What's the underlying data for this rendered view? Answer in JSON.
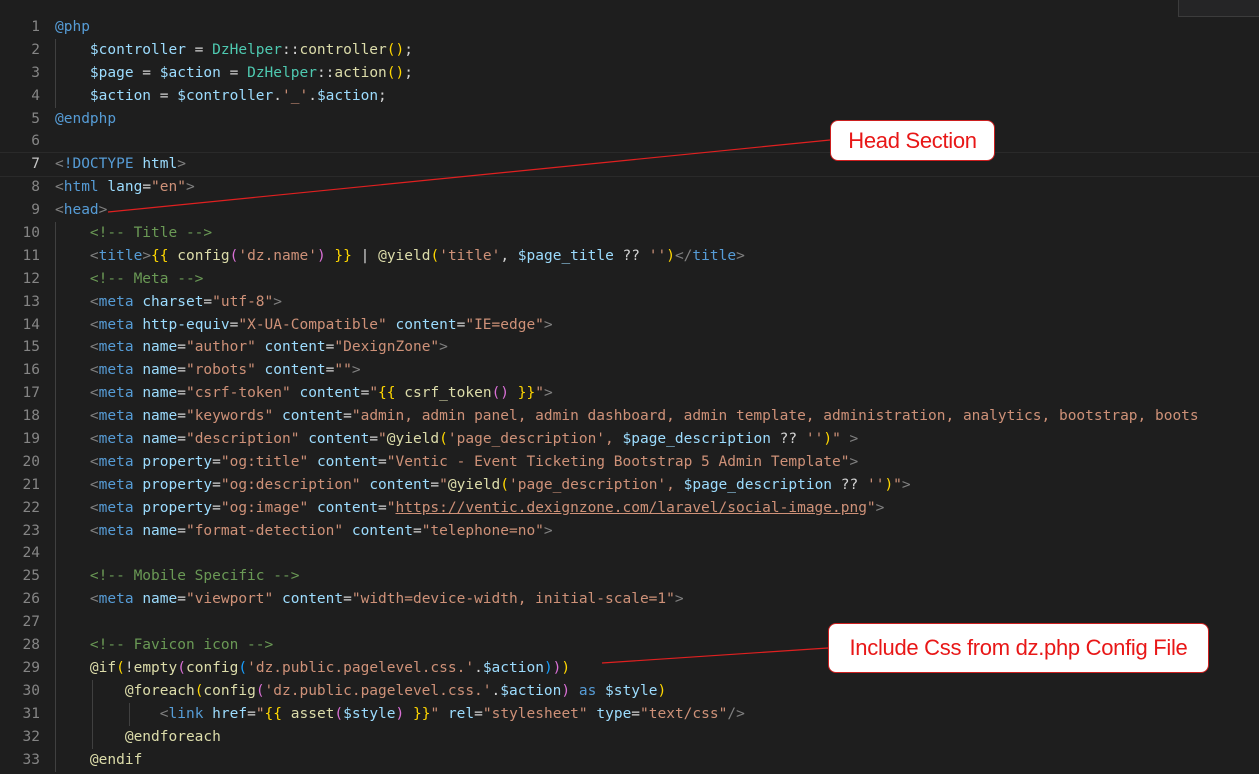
{
  "editor": {
    "lines": [
      {
        "n": "1",
        "html": "<span class='kw'>@php</span>"
      },
      {
        "n": "2",
        "html": "    <span class='var'>$controller</span> = <span class='cls'>DzHelper</span>::<span class='fn'>controller</span><span class='br1'>()</span>;"
      },
      {
        "n": "3",
        "html": "    <span class='var'>$page</span> = <span class='var'>$action</span> = <span class='cls'>DzHelper</span>::<span class='fn'>action</span><span class='br1'>()</span>;"
      },
      {
        "n": "4",
        "html": "    <span class='var'>$action</span> = <span class='var'>$controller</span>.<span class='str'>'_'</span>.<span class='var'>$action</span>;"
      },
      {
        "n": "5",
        "html": "<span class='kw'>@endphp</span>"
      },
      {
        "n": "6",
        "html": ""
      },
      {
        "n": "7",
        "html": "<span class='ang'>&lt;</span><span class='tag'>!DOCTYPE</span> <span class='attr'>html</span><span class='ang'>&gt;</span>",
        "current": true
      },
      {
        "n": "8",
        "html": "<span class='ang'>&lt;</span><span class='tag'>html</span> <span class='attr'>lang</span>=<span class='str'>\"en\"</span><span class='ang'>&gt;</span>"
      },
      {
        "n": "9",
        "html": "<span class='ang'>&lt;</span><span class='tag'>head</span><span class='ang'>&gt;</span>"
      },
      {
        "n": "10",
        "html": "    <span class='cmt'>&lt;!-- Title --&gt;</span>"
      },
      {
        "n": "11",
        "html": "    <span class='ang'>&lt;</span><span class='tag'>title</span><span class='ang'>&gt;</span><span class='br1'>{{</span> <span class='fn'>config</span><span class='br2'>(</span><span class='str'>'dz.name'</span><span class='br2'>)</span> <span class='br1'>}}</span> | <span class='fn'>@yield</span><span class='br1'>(</span><span class='str'>'title'</span>, <span class='var'>$page_title</span> ?? <span class='str'>''</span><span class='br1'>)</span><span class='ang'>&lt;/</span><span class='tag'>title</span><span class='ang'>&gt;</span>"
      },
      {
        "n": "12",
        "html": "    <span class='cmt'>&lt;!-- Meta --&gt;</span>"
      },
      {
        "n": "13",
        "html": "    <span class='ang'>&lt;</span><span class='tag'>meta</span> <span class='attr'>charset</span>=<span class='str'>\"utf-8\"</span><span class='ang'>&gt;</span>"
      },
      {
        "n": "14",
        "html": "    <span class='ang'>&lt;</span><span class='tag'>meta</span> <span class='attr'>http-equiv</span>=<span class='str'>\"X-UA-Compatible\"</span> <span class='attr'>content</span>=<span class='str'>\"IE=edge\"</span><span class='ang'>&gt;</span>"
      },
      {
        "n": "15",
        "html": "    <span class='ang'>&lt;</span><span class='tag'>meta</span> <span class='attr'>name</span>=<span class='str'>\"author\"</span> <span class='attr'>content</span>=<span class='str'>\"DexignZone\"</span><span class='ang'>&gt;</span>"
      },
      {
        "n": "16",
        "html": "    <span class='ang'>&lt;</span><span class='tag'>meta</span> <span class='attr'>name</span>=<span class='str'>\"robots\"</span> <span class='attr'>content</span>=<span class='str'>\"\"</span><span class='ang'>&gt;</span>"
      },
      {
        "n": "17",
        "html": "    <span class='ang'>&lt;</span><span class='tag'>meta</span> <span class='attr'>name</span>=<span class='str'>\"csrf-token\"</span> <span class='attr'>content</span>=<span class='str'>\"<span class='br1'>{{</span> <span class='fn'>csrf_token</span><span class='br2'>()</span> <span class='br1'>}}</span>\"</span><span class='ang'>&gt;</span>"
      },
      {
        "n": "18",
        "html": "    <span class='ang'>&lt;</span><span class='tag'>meta</span> <span class='attr'>name</span>=<span class='str'>\"keywords\"</span> <span class='attr'>content</span>=<span class='str'>\"admin, admin panel, admin dashboard, admin template, administration, analytics, bootstrap, boots</span>"
      },
      {
        "n": "19",
        "html": "    <span class='ang'>&lt;</span><span class='tag'>meta</span> <span class='attr'>name</span>=<span class='str'>\"description\"</span> <span class='attr'>content</span>=<span class='str'>\"<span class='fn'>@yield</span><span class='br1'>(</span>'page_description', <span class='var'>$page_description</span> <span class='txt'>??</span> ''<span class='br1'>)</span>\"</span> <span class='ang'>&gt;</span>"
      },
      {
        "n": "20",
        "html": "    <span class='ang'>&lt;</span><span class='tag'>meta</span> <span class='attr'>property</span>=<span class='str'>\"og:title\"</span> <span class='attr'>content</span>=<span class='str'>\"Ventic - Event Ticketing Bootstrap 5 Admin Template\"</span><span class='ang'>&gt;</span>"
      },
      {
        "n": "21",
        "html": "    <span class='ang'>&lt;</span><span class='tag'>meta</span> <span class='attr'>property</span>=<span class='str'>\"og:description\"</span> <span class='attr'>content</span>=<span class='str'>\"<span class='fn'>@yield</span><span class='br1'>(</span>'page_description', <span class='var'>$page_description</span> <span class='txt'>??</span> ''<span class='br1'>)</span>\"</span><span class='ang'>&gt;</span>"
      },
      {
        "n": "22",
        "html": "    <span class='ang'>&lt;</span><span class='tag'>meta</span> <span class='attr'>property</span>=<span class='str'>\"og:image\"</span> <span class='attr'>content</span>=<span class='str'>\"<span class='url'>https://ventic.dexignzone.com/laravel/social-image.png</span>\"</span><span class='ang'>&gt;</span>"
      },
      {
        "n": "23",
        "html": "    <span class='ang'>&lt;</span><span class='tag'>meta</span> <span class='attr'>name</span>=<span class='str'>\"format-detection\"</span> <span class='attr'>content</span>=<span class='str'>\"telephone=no\"</span><span class='ang'>&gt;</span>"
      },
      {
        "n": "24",
        "html": ""
      },
      {
        "n": "25",
        "html": "    <span class='cmt'>&lt;!-- Mobile Specific --&gt;</span>"
      },
      {
        "n": "26",
        "html": "    <span class='ang'>&lt;</span><span class='tag'>meta</span> <span class='attr'>name</span>=<span class='str'>\"viewport\"</span> <span class='attr'>content</span>=<span class='str'>\"width=device-width, initial-scale=1\"</span><span class='ang'>&gt;</span>"
      },
      {
        "n": "27",
        "html": ""
      },
      {
        "n": "28",
        "html": "    <span class='cmt'>&lt;!-- Favicon icon --&gt;</span>"
      },
      {
        "n": "29",
        "html": "    <span class='fn'>@if</span><span class='br1'>(</span>!<span class='fn'>empty</span><span class='br2'>(</span><span class='fn'>config</span><span class='br3'>(</span><span class='str'>'dz.public.pagelevel.css.'</span>.<span class='var'>$action</span><span class='br3'>)</span><span class='br2'>)</span><span class='br1'>)</span>"
      },
      {
        "n": "30",
        "html": "        <span class='fn'>@foreach</span><span class='br1'>(</span><span class='fn'>config</span><span class='br2'>(</span><span class='str'>'dz.public.pagelevel.css.'</span>.<span class='var'>$action</span><span class='br2'>)</span> <span class='kw'>as</span> <span class='var'>$style</span><span class='br1'>)</span>"
      },
      {
        "n": "31",
        "html": "            <span class='ang'>&lt;</span><span class='tag'>link</span> <span class='attr'>href</span>=<span class='str'>\"<span class='br1'>{{</span> <span class='fn'>asset</span><span class='br2'>(</span><span class='var'>$style</span><span class='br2'>)</span> <span class='br1'>}}</span>\"</span> <span class='attr'>rel</span>=<span class='str'>\"stylesheet\"</span> <span class='attr'>type</span>=<span class='str'>\"text/css\"</span><span class='ang'>/&gt;</span>"
      },
      {
        "n": "32",
        "html": "        <span class='fn'>@endforeach</span>"
      },
      {
        "n": "33",
        "html": "    <span class='fn'>@endif</span>"
      }
    ]
  },
  "callouts": {
    "head_section": "Head Section",
    "include_css": "Include Css from dz.php Config File"
  },
  "colors": {
    "callout_border": "#cc1f1f",
    "callout_text": "#e81717",
    "arrow": "#e02020",
    "background": "#1e1e1e"
  }
}
